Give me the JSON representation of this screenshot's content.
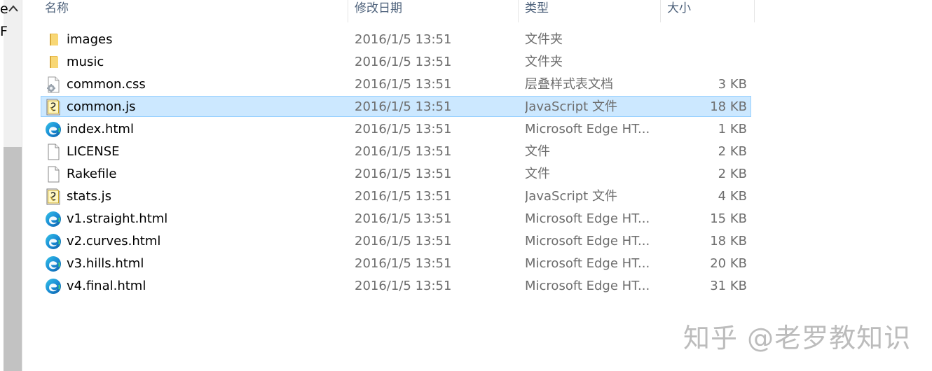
{
  "nav": {
    "text_top": "e",
    "text_bottom": "F"
  },
  "columns": {
    "name": "名称",
    "date": "修改日期",
    "type": "类型",
    "size": "大小"
  },
  "files": [
    {
      "name": "images",
      "date": "2016/1/5 13:51",
      "type": "文件夹",
      "size": "",
      "icon": "folder-icon"
    },
    {
      "name": "music",
      "date": "2016/1/5 13:51",
      "type": "文件夹",
      "size": "",
      "icon": "folder-icon"
    },
    {
      "name": "common.css",
      "date": "2016/1/5 13:51",
      "type": "层叠样式表文档",
      "size": "3 KB",
      "icon": "css-file-icon"
    },
    {
      "name": "common.js",
      "date": "2016/1/5 13:51",
      "type": "JavaScript 文件",
      "size": "18 KB",
      "icon": "js-file-icon",
      "selected": true
    },
    {
      "name": "index.html",
      "date": "2016/1/5 13:51",
      "type": "Microsoft Edge HT...",
      "size": "1 KB",
      "icon": "edge-icon"
    },
    {
      "name": "LICENSE",
      "date": "2016/1/5 13:51",
      "type": "文件",
      "size": "2 KB",
      "icon": "blank-file-icon"
    },
    {
      "name": "Rakefile",
      "date": "2016/1/5 13:51",
      "type": "文件",
      "size": "2 KB",
      "icon": "blank-file-icon"
    },
    {
      "name": "stats.js",
      "date": "2016/1/5 13:51",
      "type": "JavaScript 文件",
      "size": "4 KB",
      "icon": "js-file-icon"
    },
    {
      "name": "v1.straight.html",
      "date": "2016/1/5 13:51",
      "type": "Microsoft Edge HT...",
      "size": "15 KB",
      "icon": "edge-icon"
    },
    {
      "name": "v2.curves.html",
      "date": "2016/1/5 13:51",
      "type": "Microsoft Edge HT...",
      "size": "18 KB",
      "icon": "edge-icon"
    },
    {
      "name": "v3.hills.html",
      "date": "2016/1/5 13:51",
      "type": "Microsoft Edge HT...",
      "size": "20 KB",
      "icon": "edge-icon"
    },
    {
      "name": "v4.final.html",
      "date": "2016/1/5 13:51",
      "type": "Microsoft Edge HT...",
      "size": "31 KB",
      "icon": "edge-icon"
    }
  ],
  "watermark": "知乎 @老罗教知识",
  "colors": {
    "selection": "#cce8ff",
    "selection_border": "#99d1ff",
    "header_text": "#4c607a",
    "secondary_text": "#6d6d6d",
    "folder": "#f8d775"
  }
}
